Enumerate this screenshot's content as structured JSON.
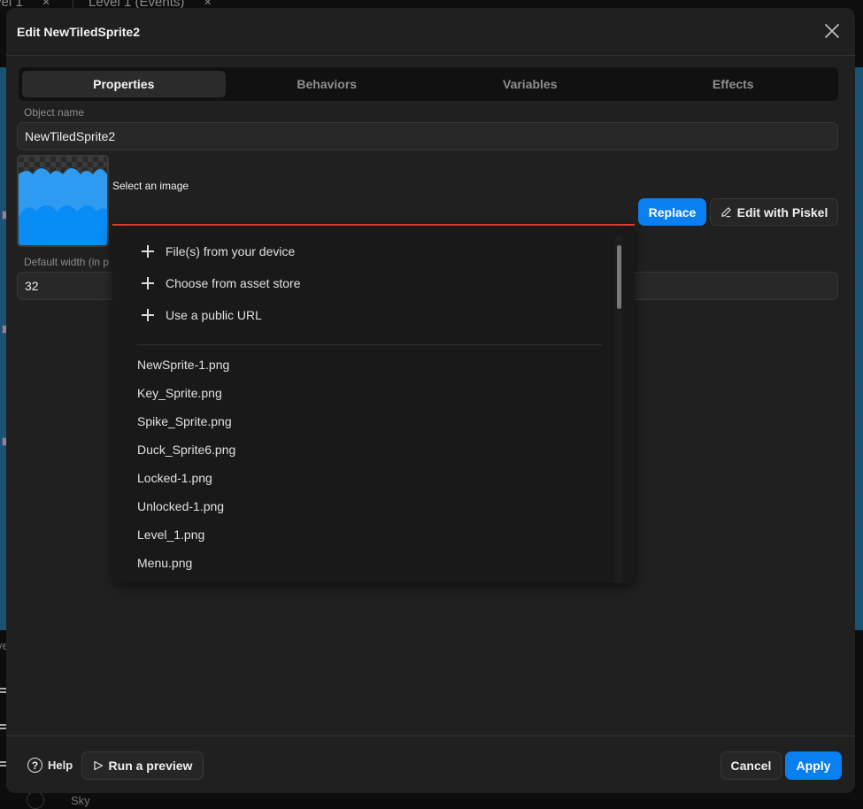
{
  "background_app": {
    "tabs": [
      {
        "label": "vel 1"
      },
      {
        "label": "Level 1 (Events)"
      }
    ],
    "tab_close_glyph": "×",
    "partial_texts": {
      "left_edge": "ve",
      "bottom": "Sky"
    }
  },
  "dialog": {
    "title": "Edit NewTiledSprite2",
    "close_icon": "close-icon"
  },
  "tabs": [
    {
      "label": "Properties",
      "active": true
    },
    {
      "label": "Behaviors",
      "active": false
    },
    {
      "label": "Variables",
      "active": false
    },
    {
      "label": "Effects",
      "active": false
    }
  ],
  "object_name": {
    "label": "Object name",
    "value": "NewTiledSprite2"
  },
  "image_selector": {
    "label": "Select an image",
    "replace_label": "Replace",
    "edit_piskel_label": "Edit with Piskel",
    "edit_icon": "pencil-icon"
  },
  "default_width": {
    "label": "Default width (in p",
    "value": "32"
  },
  "dropdown": {
    "actions": [
      {
        "label": "File(s) from your device",
        "icon": "plus-icon"
      },
      {
        "label": "Choose from asset store",
        "icon": "plus-icon"
      },
      {
        "label": "Use a public URL",
        "icon": "plus-icon"
      }
    ],
    "items": [
      "NewSprite-1.png",
      "Key_Sprite.png",
      "Spike_Sprite.png",
      "Duck_Sprite6.png",
      "Locked-1.png",
      "Unlocked-1.png",
      "Level_1.png",
      "Menu.png"
    ]
  },
  "footer": {
    "help_label": "Help",
    "help_glyph": "?",
    "run_preview_label": "Run a preview",
    "cancel_label": "Cancel",
    "apply_label": "Apply"
  },
  "colors": {
    "accent": "#0a7ff0",
    "error_underline": "#e8433a",
    "dialog_bg": "#202020",
    "canvas_bg": "#1a5273"
  }
}
